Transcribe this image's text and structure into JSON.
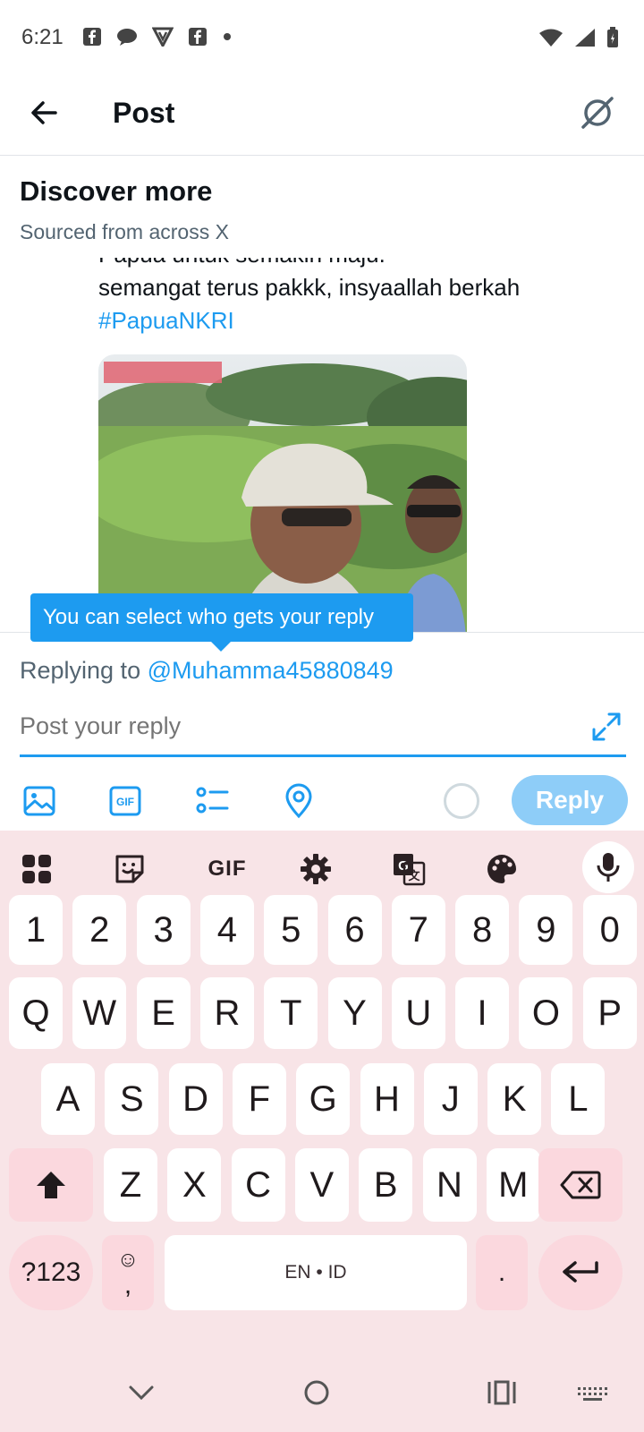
{
  "status_bar": {
    "time": "6:21"
  },
  "header": {
    "title": "Post"
  },
  "discover": {
    "title": "Discover more",
    "subtitle": "Sourced from across X"
  },
  "post": {
    "line_partial": "Papua untuk semakin maju.",
    "line2": "semangat terus pakkk, insyaallah berkah",
    "hashtag": "#PapuaNKRI"
  },
  "tooltip": {
    "text": "You can select who gets your reply"
  },
  "reply": {
    "replying_prefix": "Replying to ",
    "handle": "@Muhamma45880849",
    "placeholder": "Post your reply",
    "button_label": "Reply"
  },
  "keyboard": {
    "gif_label": "GIF",
    "number_row": [
      "1",
      "2",
      "3",
      "4",
      "5",
      "6",
      "7",
      "8",
      "9",
      "0"
    ],
    "row1": [
      "Q",
      "W",
      "E",
      "R",
      "T",
      "Y",
      "U",
      "I",
      "O",
      "P"
    ],
    "row2": [
      "A",
      "S",
      "D",
      "F",
      "G",
      "H",
      "J",
      "K",
      "L"
    ],
    "row3": [
      "Z",
      "X",
      "C",
      "V",
      "B",
      "N",
      "M"
    ],
    "symbols_label": "?123",
    "emoji_top": "☺",
    "comma": ",",
    "space_label": "EN • ID",
    "period": "."
  },
  "colors": {
    "accent": "#1d9bf0",
    "reply_disabled": "#8ecdf8",
    "keyboard_bg": "#f8e4e7",
    "key_special": "#fbd8de"
  }
}
